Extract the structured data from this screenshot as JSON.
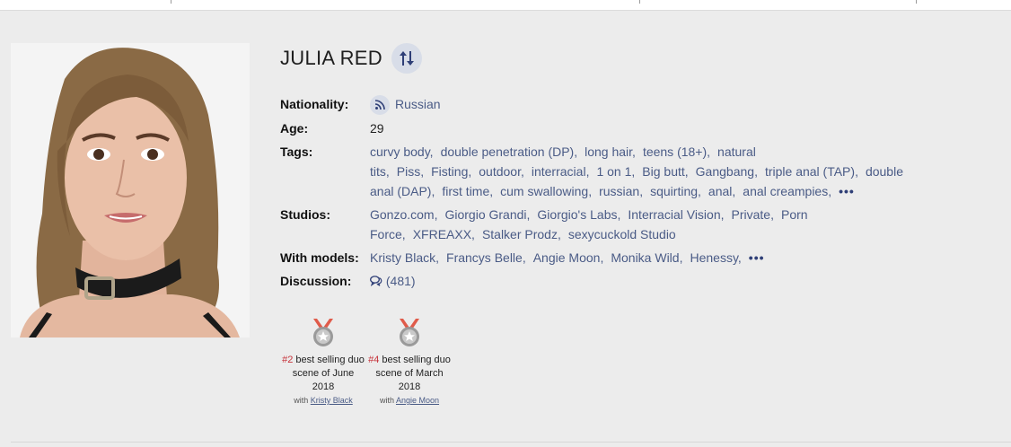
{
  "model": {
    "name": "JULIA RED",
    "nationality_label": "Nationality:",
    "nationality": "Russian",
    "age_label": "Age:",
    "age": "29",
    "tags_label": "Tags:",
    "tags": [
      "curvy body",
      "double penetration (DP)",
      "long hair",
      "teens (18+)",
      "natural tits",
      "Piss",
      "Fisting",
      "outdoor",
      "interracial",
      "1 on 1",
      "Big butt",
      "Gangbang",
      "triple anal (TAP)",
      "double anal (DAP)",
      "first time",
      "cum swallowing",
      "russian",
      "squirting",
      "anal",
      "anal creampies"
    ],
    "studios_label": "Studios:",
    "studios": [
      "Gonzo.com",
      "Giorgio Grandi",
      "Giorgio's Labs",
      "Interracial Vision",
      "Private",
      "Porn Force",
      "XFREAXX",
      "Stalker Prodz",
      "sexycuckold Studio"
    ],
    "models_label": "With models:",
    "models": [
      "Kristy Black",
      "Francys Belle",
      "Angie Moon",
      "Monika Wild",
      "Henessy"
    ],
    "discussion_label": "Discussion:",
    "discussion_count": "(481)",
    "more_label": "•••"
  },
  "icons": {
    "sort": "sort-arrows-icon",
    "nationality": "rss-icon",
    "discussion": "comments-icon",
    "award": "medal-icon"
  },
  "colors": {
    "accent": "#4a5b86",
    "rank": "#c6323a",
    "background": "#ececec"
  },
  "awards": [
    {
      "rank": "#2",
      "text": "best selling duo scene of June 2018",
      "with": "with",
      "partner": "Kristy Black"
    },
    {
      "rank": "#4",
      "text": "best selling duo scene of March 2018",
      "with": "with",
      "partner": "Angie Moon"
    }
  ]
}
